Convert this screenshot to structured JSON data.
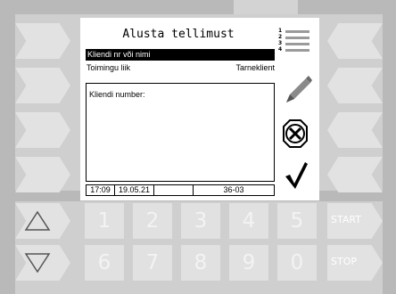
{
  "header": {
    "title": "Alusta tellimust",
    "menu_icon": "numbered-list-icon",
    "menu_numbers": [
      "1",
      "2",
      "3",
      "4"
    ]
  },
  "form": {
    "selected_field": "Kliendi nr või nimi",
    "operation_type_label": "Toimingu liik",
    "operation_type_value": "Tarneklient",
    "input_label": "Kliendi number:"
  },
  "status_bar": {
    "time": "17:09",
    "date": "19.05.21",
    "empty_cell": "",
    "code": "36-03"
  },
  "actions": {
    "edit_icon": "pencil-icon",
    "cancel_icon": "cancel-x-icon",
    "confirm_icon": "checkmark-icon"
  },
  "keypad": {
    "row1": [
      "1",
      "2",
      "3",
      "4",
      "5"
    ],
    "row2": [
      "6",
      "7",
      "8",
      "9",
      "0"
    ],
    "up_icon": "up-triangle-icon",
    "down_icon": "down-triangle-icon",
    "start_label": "START",
    "stop_label": "STOP"
  },
  "colors": {
    "frame": "#b9b9b9",
    "panel": "#cfcfcf",
    "key": "#e2e2e2",
    "screen": "#ffffff",
    "selection": "#000000"
  }
}
